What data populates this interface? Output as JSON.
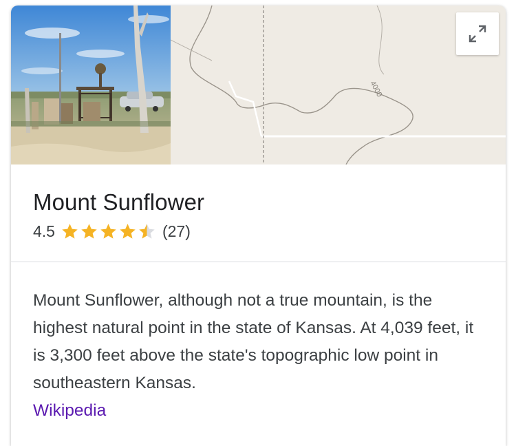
{
  "place": {
    "name": "Mount Sunflower",
    "rating": "4.5",
    "rating_value": 4.5,
    "rating_max": 5,
    "review_count": "(27)"
  },
  "map": {
    "contour_label": "4000"
  },
  "description": {
    "text": "Mount Sunflower, although not a true mountain, is the highest natural point in the state of Kansas. At 4,039 feet, it is 3,300 feet above the state's topographic low point in southeastern Kansas.",
    "source_label": "Wikipedia"
  },
  "icons": {
    "expand": "expand-icon",
    "star": "star-icon"
  },
  "colors": {
    "star_fill": "#f5b324",
    "star_empty": "#dadce0",
    "link": "#5b1ab0",
    "map_background": "#efebe4"
  }
}
